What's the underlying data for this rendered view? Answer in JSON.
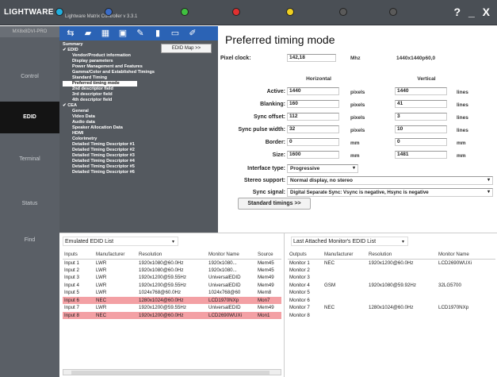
{
  "app": {
    "logo": "LIGHTWARE",
    "subtitle": "Lightware Matrix Controller v 3.3.1",
    "window_controls": "? _ X"
  },
  "leds": [
    {
      "color": "#20b0e0"
    },
    {
      "color": "#3a6cc8"
    },
    {
      "color": "#40c040"
    },
    {
      "color": "#e03030"
    },
    {
      "color": "#f0d020"
    },
    {
      "color": "#5a5a5a"
    },
    {
      "color": "#5a5a5a"
    }
  ],
  "sidebar": {
    "device_name": "MX8x8DVI-PRO",
    "items": [
      {
        "label": "Control"
      },
      {
        "label": "EDID"
      },
      {
        "label": "Terminal"
      },
      {
        "label": "Status"
      },
      {
        "label": "Find"
      }
    ]
  },
  "toolbar": {
    "icons": [
      "matrix-icon",
      "open-folder-icon",
      "grid-icon",
      "save-icon",
      "edit-icon",
      "device-icon",
      "monitor-icon",
      "pen-icon"
    ],
    "edid_map_label": "EDID Map >>"
  },
  "tree": [
    {
      "label": "Summary",
      "bold": true
    },
    {
      "label": "✔ EDID",
      "bold": true
    },
    {
      "label": "Vendor/Product information",
      "bold": true,
      "indent": 2
    },
    {
      "label": "Display parameters",
      "bold": true,
      "indent": 2
    },
    {
      "label": "Power Management and Features",
      "bold": true,
      "indent": 2
    },
    {
      "label": "Gamma/Color and Established Timings",
      "bold": true,
      "indent": 2
    },
    {
      "label": "Standard Timing",
      "bold": true,
      "indent": 2
    },
    {
      "label": "Preferred timing mode",
      "bold": true,
      "indent": 2,
      "selected": true
    },
    {
      "label": "2nd descriptor field",
      "bold": true,
      "indent": 2
    },
    {
      "label": "3rd descriptor field",
      "bold": true,
      "indent": 2
    },
    {
      "label": "4th descriptor field",
      "bold": true,
      "indent": 2
    },
    {
      "label": "✔ CEA",
      "bold": true
    },
    {
      "label": "General",
      "bold": true,
      "indent": 2
    },
    {
      "label": "Video Data",
      "bold": true,
      "indent": 2
    },
    {
      "label": "Audio data",
      "bold": true,
      "indent": 2
    },
    {
      "label": "Speaker Allocation Data",
      "bold": true,
      "indent": 2
    },
    {
      "label": "HDMI",
      "bold": true,
      "indent": 2
    },
    {
      "label": "Colorimetry",
      "bold": true,
      "indent": 2
    },
    {
      "label": "Detailed Timing Descriptor #1",
      "bold": true,
      "indent": 2
    },
    {
      "label": "Detailed Timing Descriptor #2",
      "bold": true,
      "indent": 2
    },
    {
      "label": "Detailed Timing Descriptor #3",
      "bold": true,
      "indent": 2
    },
    {
      "label": "Detailed Timing Descriptor #4",
      "bold": true,
      "indent": 2
    },
    {
      "label": "Detailed Timing Descriptor #5",
      "bold": true,
      "indent": 2
    },
    {
      "label": "Detailed Timing Descriptor #6",
      "bold": true,
      "indent": 2
    }
  ],
  "detail": {
    "title": "Preferred timing mode",
    "pixel_clock": {
      "label": "Pixel clock:",
      "value": "142,18",
      "unit": "Mhz",
      "summary": "1440x1440p60,0"
    },
    "headers": {
      "horizontal": "Horizontal",
      "vertical": "Vertical"
    },
    "rows": [
      {
        "label": "Active:",
        "h": "1440",
        "hu": "pixels",
        "v": "1440",
        "vu": "lines"
      },
      {
        "label": "Blanking:",
        "h": "160",
        "hu": "pixels",
        "v": "41",
        "vu": "lines"
      },
      {
        "label": "Sync offset:",
        "h": "112",
        "hu": "pixels",
        "v": "3",
        "vu": "lines"
      },
      {
        "label": "Sync pulse width:",
        "h": "32",
        "hu": "pixels",
        "v": "10",
        "vu": "lines"
      },
      {
        "label": "Border:",
        "h": "0",
        "hu": "mm",
        "v": "0",
        "vu": "mm"
      },
      {
        "label": "Size:",
        "h": "1600",
        "hu": "mm",
        "v": "1481",
        "vu": "mm"
      }
    ],
    "interface_type": {
      "label": "Interface type:",
      "value": "Progressive"
    },
    "stereo_support": {
      "label": "Stereo support:",
      "value": "Normal display, no stereo"
    },
    "sync_signal": {
      "label": "Sync signal:",
      "value": "Digital Separate Sync: Vsync is negative, Hsync is negative"
    },
    "standard_timings_button": "Standard timings >>"
  },
  "emulated": {
    "selector": "Emulated EDID List",
    "columns": [
      "Inputs",
      "Manufacturer",
      "Resolution",
      "Monitor Name",
      "Source"
    ],
    "rows": [
      {
        "cells": [
          "Input 1",
          "LWR",
          "1920x1080@60.0Hz",
          "1920x1080...",
          "Mem45"
        ],
        "hl": false
      },
      {
        "cells": [
          "Input 2",
          "LWR",
          "1920x1080@60.0Hz",
          "1920x1080...",
          "Mem45"
        ],
        "hl": false
      },
      {
        "cells": [
          "Input 3",
          "LWR",
          "1920x1200@59.55Hz",
          "UniversalEDID",
          "Mem49"
        ],
        "hl": false
      },
      {
        "cells": [
          "Input 4",
          "LWR",
          "1920x1200@59.55Hz",
          "UniversalEDID",
          "Mem49"
        ],
        "hl": false
      },
      {
        "cells": [
          "Input 5",
          "LWR",
          "1024x768@60.0Hz",
          "1024x768@60",
          "Mem8"
        ],
        "hl": false
      },
      {
        "cells": [
          "Input 6",
          "NEC",
          "1280x1024@60.0Hz",
          "LCD1970NXp",
          "Mon7"
        ],
        "hl": true
      },
      {
        "cells": [
          "Input 7",
          "LWR",
          "1920x1200@59.55Hz",
          "UniversalEDID",
          "Mem49"
        ],
        "hl": false
      },
      {
        "cells": [
          "Input 8",
          "NEC",
          "1920x1200@60.0Hz",
          "LCD2690WUXi",
          "Mon1"
        ],
        "hl": true
      }
    ]
  },
  "attached": {
    "selector": "Last Attached Monitor's EDID List",
    "columns": [
      "Outputs",
      "Manufacturer",
      "Resolution",
      "Monitor Name"
    ],
    "rows": [
      [
        "Monitor 1",
        "NEC",
        "1920x1200@60.0Hz",
        "LCD2690WUXi"
      ],
      [
        "Monitor 2",
        "",
        "",
        ""
      ],
      [
        "Monitor 3",
        "",
        "",
        ""
      ],
      [
        "Monitor 4",
        "GSM",
        "1920x1080@59.92Hz",
        "32LG5700"
      ],
      [
        "Monitor 5",
        "",
        "",
        ""
      ],
      [
        "Monitor 6",
        "",
        "",
        ""
      ],
      [
        "Monitor 7",
        "NEC",
        "1280x1024@60.0Hz",
        "LCD1970NXp"
      ],
      [
        "Monitor 8",
        "",
        "",
        ""
      ]
    ]
  }
}
